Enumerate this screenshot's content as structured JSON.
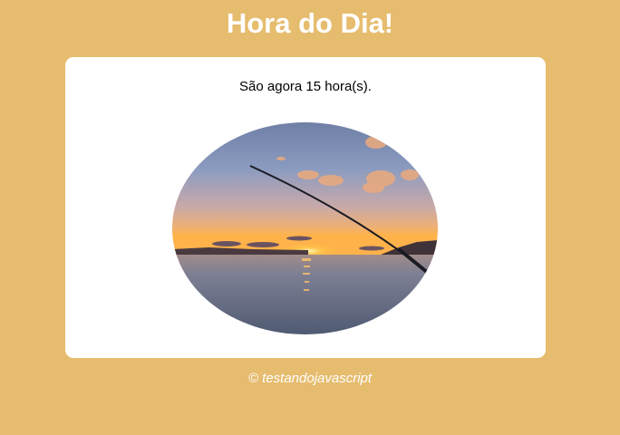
{
  "page": {
    "title": "Hora do Dia!",
    "background_color": "#e6bc6e"
  },
  "card": {
    "message_prefix": "São agora ",
    "hour": 15,
    "message_suffix": " hora(s).",
    "image_icon": "sunset-fishing-photo"
  },
  "footer": {
    "text": "© testandojavascript"
  }
}
